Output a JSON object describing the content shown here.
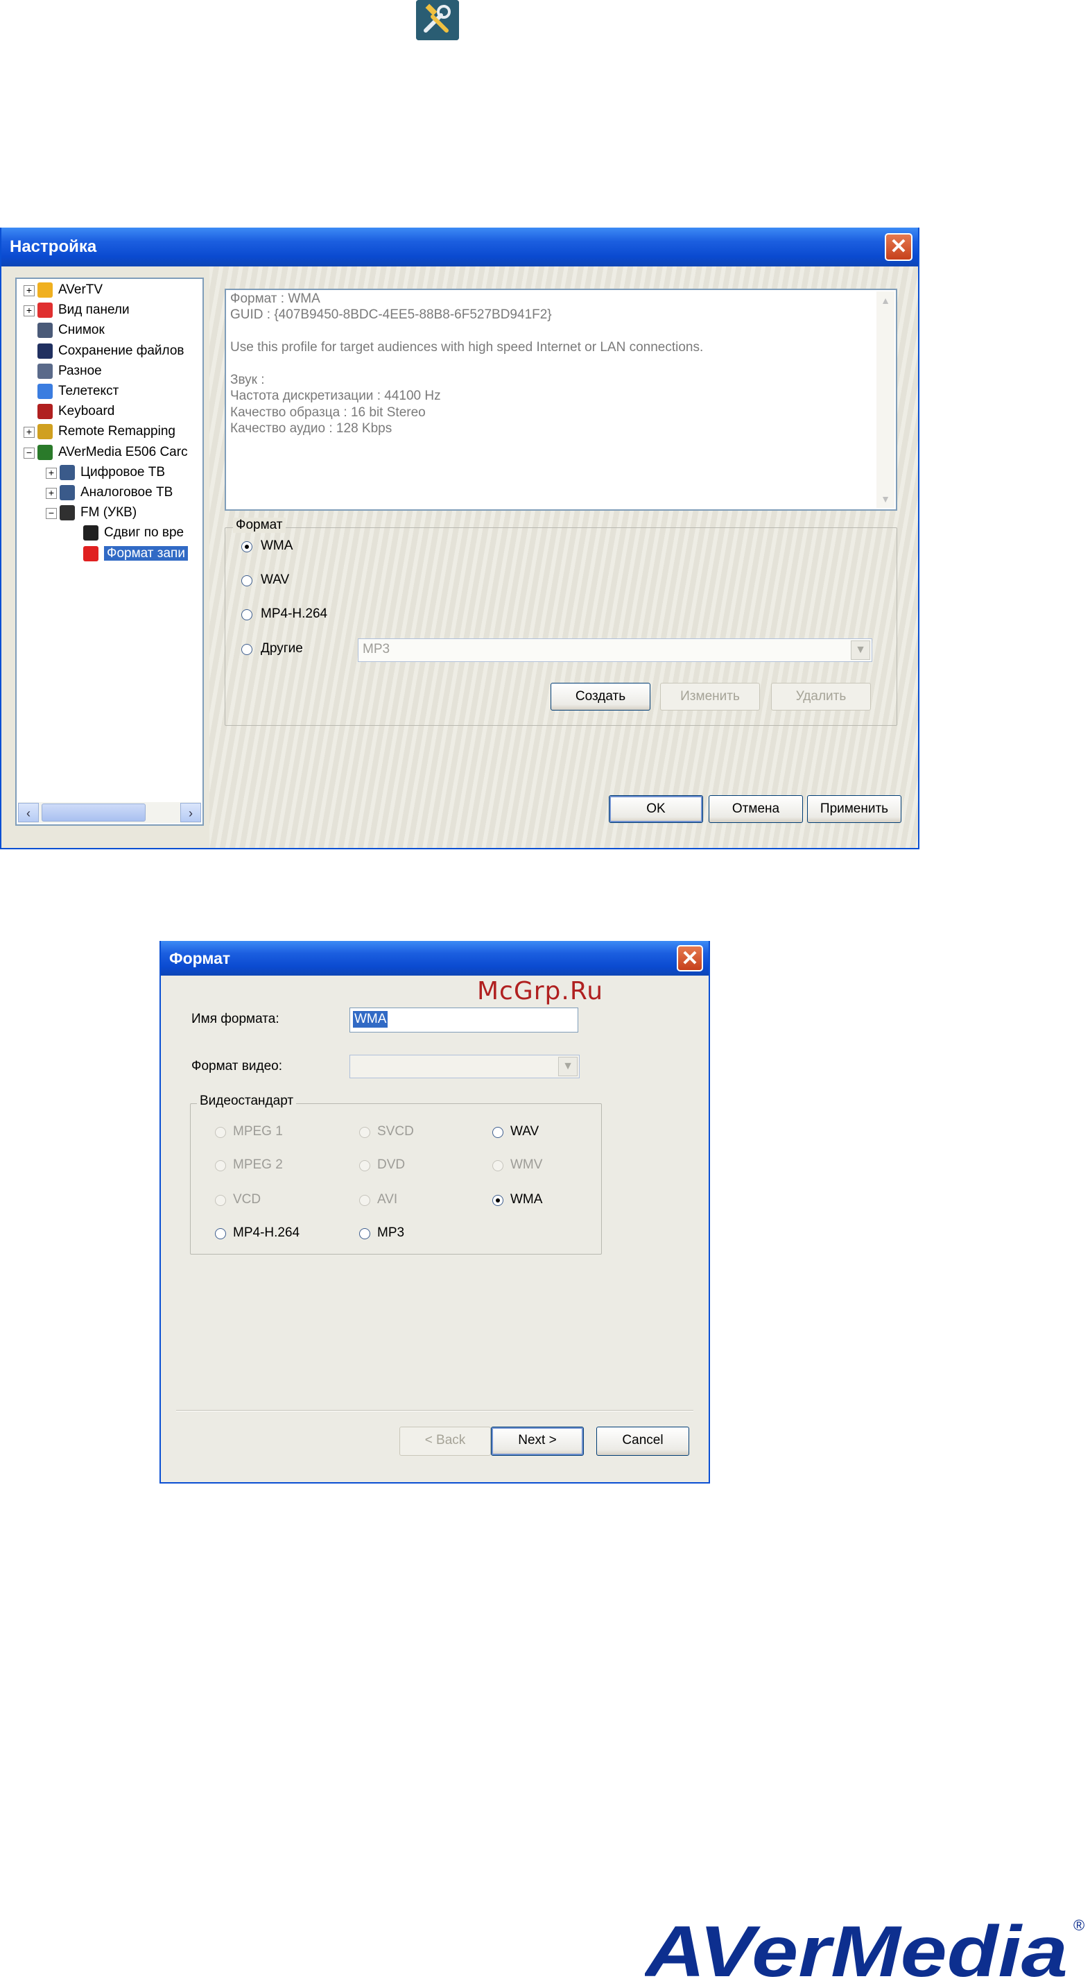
{
  "settings_window": {
    "title": "Настройка",
    "close_label": "✕",
    "tree": [
      {
        "label": "AVerTV",
        "icon": "avertv-icon",
        "color": "#f0b020"
      },
      {
        "label": "Вид панели",
        "icon": "panel-view-icon",
        "color": "#e03030"
      },
      {
        "label": "Снимок",
        "icon": "camera-icon",
        "color": "#4a5a78"
      },
      {
        "label": "Сохранение файлов",
        "icon": "floppy-icon",
        "color": "#203060"
      },
      {
        "label": "Разное",
        "icon": "tools-misc-icon",
        "color": "#5a6a8a"
      },
      {
        "label": "Телетекст",
        "icon": "text-icon",
        "color": "#3b7de0"
      },
      {
        "label": "Keyboard",
        "icon": "keyboard-icon",
        "color": "#b02020"
      },
      {
        "label": "Remote Remapping",
        "icon": "remote-icon",
        "color": "#d0a020"
      },
      {
        "label": "AVerMedia E506 Carc",
        "icon": "device-card-icon",
        "color": "#2a7a2a"
      },
      {
        "label": "Цифровое ТВ",
        "icon": "digital-tv-icon",
        "color": "#3a5a8a"
      },
      {
        "label": "Аналоговое ТВ",
        "icon": "analog-tv-icon",
        "color": "#3a5a8a"
      },
      {
        "label": "FM (УКВ)",
        "icon": "fm-radio-icon",
        "color": "#303030"
      },
      {
        "label": "Сдвиг по вре",
        "icon": "timeshift-icon",
        "color": "#202020"
      },
      {
        "label": "Формат запи",
        "icon": "record-icon",
        "color": "#e02020"
      }
    ],
    "info_lines": [
      "Формат : WMA",
      "GUID : {407B9450-8BDC-4EE5-88B8-6F527BD941F2}",
      "",
      "Use this profile for target audiences with high speed Internet or LAN connections.",
      "",
      "Звук :",
      "Частота дискретизации : 44100 Hz",
      "Качество образца : 16 bit Stereo",
      "Качество аудио : 128 Kbps"
    ],
    "format_group_label": "Формат",
    "format_options": [
      {
        "label": "WMA",
        "checked": true
      },
      {
        "label": "WAV",
        "checked": false
      },
      {
        "label": "MP4-H.264",
        "checked": false
      },
      {
        "label": "Другие",
        "checked": false
      }
    ],
    "other_combo_value": "MP3",
    "buttons": {
      "create": "Создать",
      "edit": "Изменить",
      "delete": "Удалить",
      "ok": "OK",
      "cancel": "Отмена",
      "apply": "Применить"
    }
  },
  "format_window": {
    "title": "Формат",
    "close_label": "✕",
    "name_label": "Имя формата:",
    "name_value": "WMA",
    "video_format_label": "Формат видео:",
    "video_standard_label": "Видеостандарт",
    "standards": [
      {
        "label": "MPEG 1",
        "enabled": false,
        "checked": false
      },
      {
        "label": "SVCD",
        "enabled": false,
        "checked": false
      },
      {
        "label": "WAV",
        "enabled": true,
        "checked": false
      },
      {
        "label": "MPEG 2",
        "enabled": false,
        "checked": false
      },
      {
        "label": "DVD",
        "enabled": false,
        "checked": false
      },
      {
        "label": "WMV",
        "enabled": false,
        "checked": false
      },
      {
        "label": "VCD",
        "enabled": false,
        "checked": false
      },
      {
        "label": "AVI",
        "enabled": false,
        "checked": false
      },
      {
        "label": "WMA",
        "enabled": true,
        "checked": true
      },
      {
        "label": "MP4-H.264",
        "enabled": true,
        "checked": false
      },
      {
        "label": "MP3",
        "enabled": true,
        "checked": false
      }
    ],
    "buttons": {
      "back": "< Back",
      "next": "Next >",
      "cancel": "Cancel"
    }
  },
  "watermark": "McGrp.Ru",
  "logo": {
    "text": "AVerMedia",
    "mark": "®",
    "color": "#0d2f8f"
  }
}
